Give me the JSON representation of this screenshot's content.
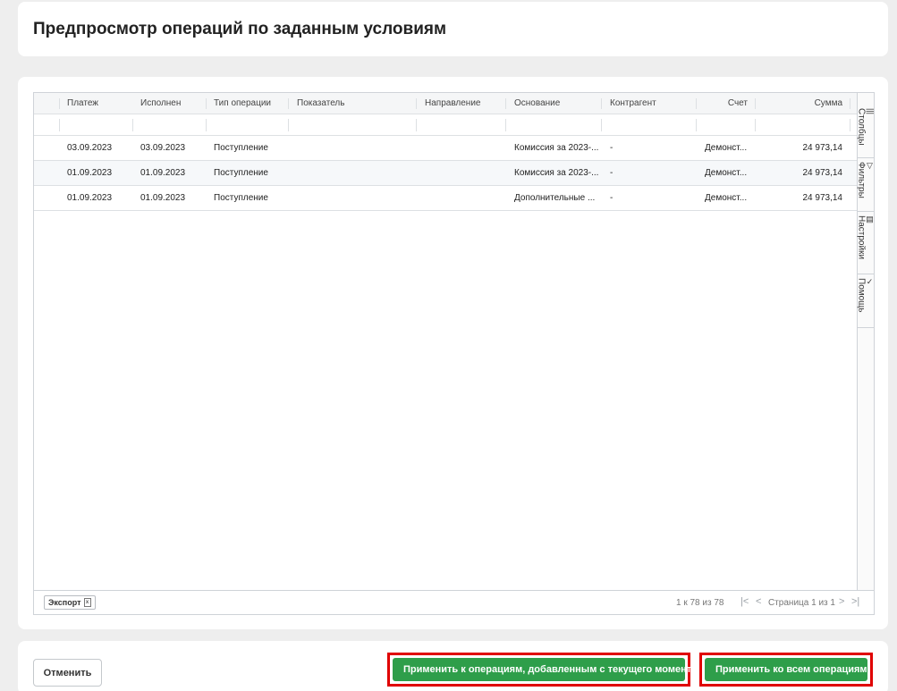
{
  "title": "Предпросмотр операций по заданным условиям",
  "table": {
    "columns": [
      "Платеж",
      "Исполнен",
      "Тип операции",
      "Показатель",
      "Направление",
      "Основание",
      "Контрагент",
      "Счет",
      "Сумма"
    ],
    "rows": [
      [
        "03.09.2023",
        "03.09.2023",
        "Поступление",
        "",
        "",
        "Комиссия за 2023-...",
        "-",
        "Демонст...",
        "24 973,14"
      ],
      [
        "01.09.2023",
        "01.09.2023",
        "Поступление",
        "",
        "",
        "Комиссия за 2023-...",
        "-",
        "Демонст...",
        "24 973,14"
      ],
      [
        "01.09.2023",
        "01.09.2023",
        "Поступление",
        "",
        "",
        "Дополнительные ...",
        "-",
        "Демонст...",
        "24 973,14"
      ]
    ]
  },
  "side_tabs": [
    {
      "label": "Столбцы",
      "icon": "columns-icon",
      "glyph": "|||"
    },
    {
      "label": "Фильтры",
      "icon": "filter-icon",
      "glyph": "▽"
    },
    {
      "label": "Настройки",
      "icon": "settings-icon",
      "glyph": "▤"
    },
    {
      "label": "Помощь",
      "icon": "help-icon",
      "glyph": "✓"
    }
  ],
  "footer": {
    "export_label": "Экспорт",
    "row_count": "1 к 78 из 78",
    "page_info": "Страница 1 из 1"
  },
  "actions": {
    "cancel": "Отменить",
    "apply_from_now": "Применить к операциям, добавленным с текущего момента",
    "apply_all": "Применить ко всем операциям"
  },
  "colors": {
    "primary_button": "#2e9e4a",
    "highlight_border": "#e00000"
  }
}
